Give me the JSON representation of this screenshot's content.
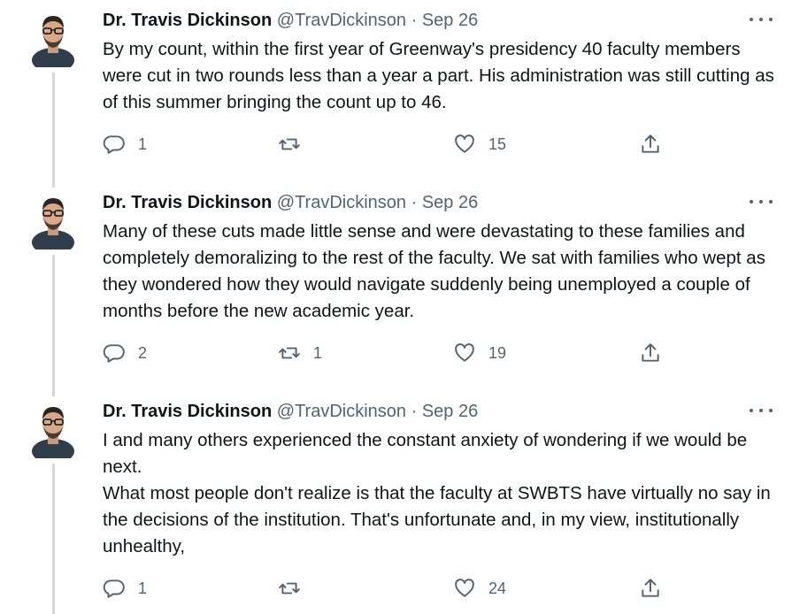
{
  "tweets": [
    {
      "author": {
        "name": "Dr. Travis Dickinson",
        "handle": "@TravDickinson",
        "separator": "·",
        "date": "Sep 26"
      },
      "paragraphs": [
        "By my count, within the first year of Greenway's presidency 40 faculty members were cut in two rounds less than a year a part. His administration was still cutting as of this summer bringing the count up to 46."
      ],
      "replies": "1",
      "retweets": "",
      "likes": "15"
    },
    {
      "author": {
        "name": "Dr. Travis Dickinson",
        "handle": "@TravDickinson",
        "separator": "·",
        "date": "Sep 26"
      },
      "paragraphs": [
        "Many of these cuts made little sense and were devastating to these families and completely demoralizing to the rest of the faculty. We sat with families who wept as they wondered how they would navigate suddenly being unemployed a couple of months before the new academic year."
      ],
      "replies": "2",
      "retweets": "1",
      "likes": "19"
    },
    {
      "author": {
        "name": "Dr. Travis Dickinson",
        "handle": "@TravDickinson",
        "separator": "·",
        "date": "Sep 26"
      },
      "paragraphs": [
        "I and many others experienced the constant anxiety of wondering if we would be next.",
        "What most people don't realize is that the faculty at SWBTS have virtually no say in the decisions of the institution. That's unfortunate and, in my view, institutionally unhealthy,"
      ],
      "replies": "1",
      "retweets": "",
      "likes": "24"
    }
  ],
  "icons": {
    "more": "more-dots-icon",
    "reply": "reply-icon",
    "retweet": "retweet-icon",
    "like": "heart-icon",
    "share": "share-icon"
  },
  "colors": {
    "text": "#0f1419",
    "muted": "#536471",
    "thread_line": "#cfd9de",
    "background": "#ffffff"
  }
}
